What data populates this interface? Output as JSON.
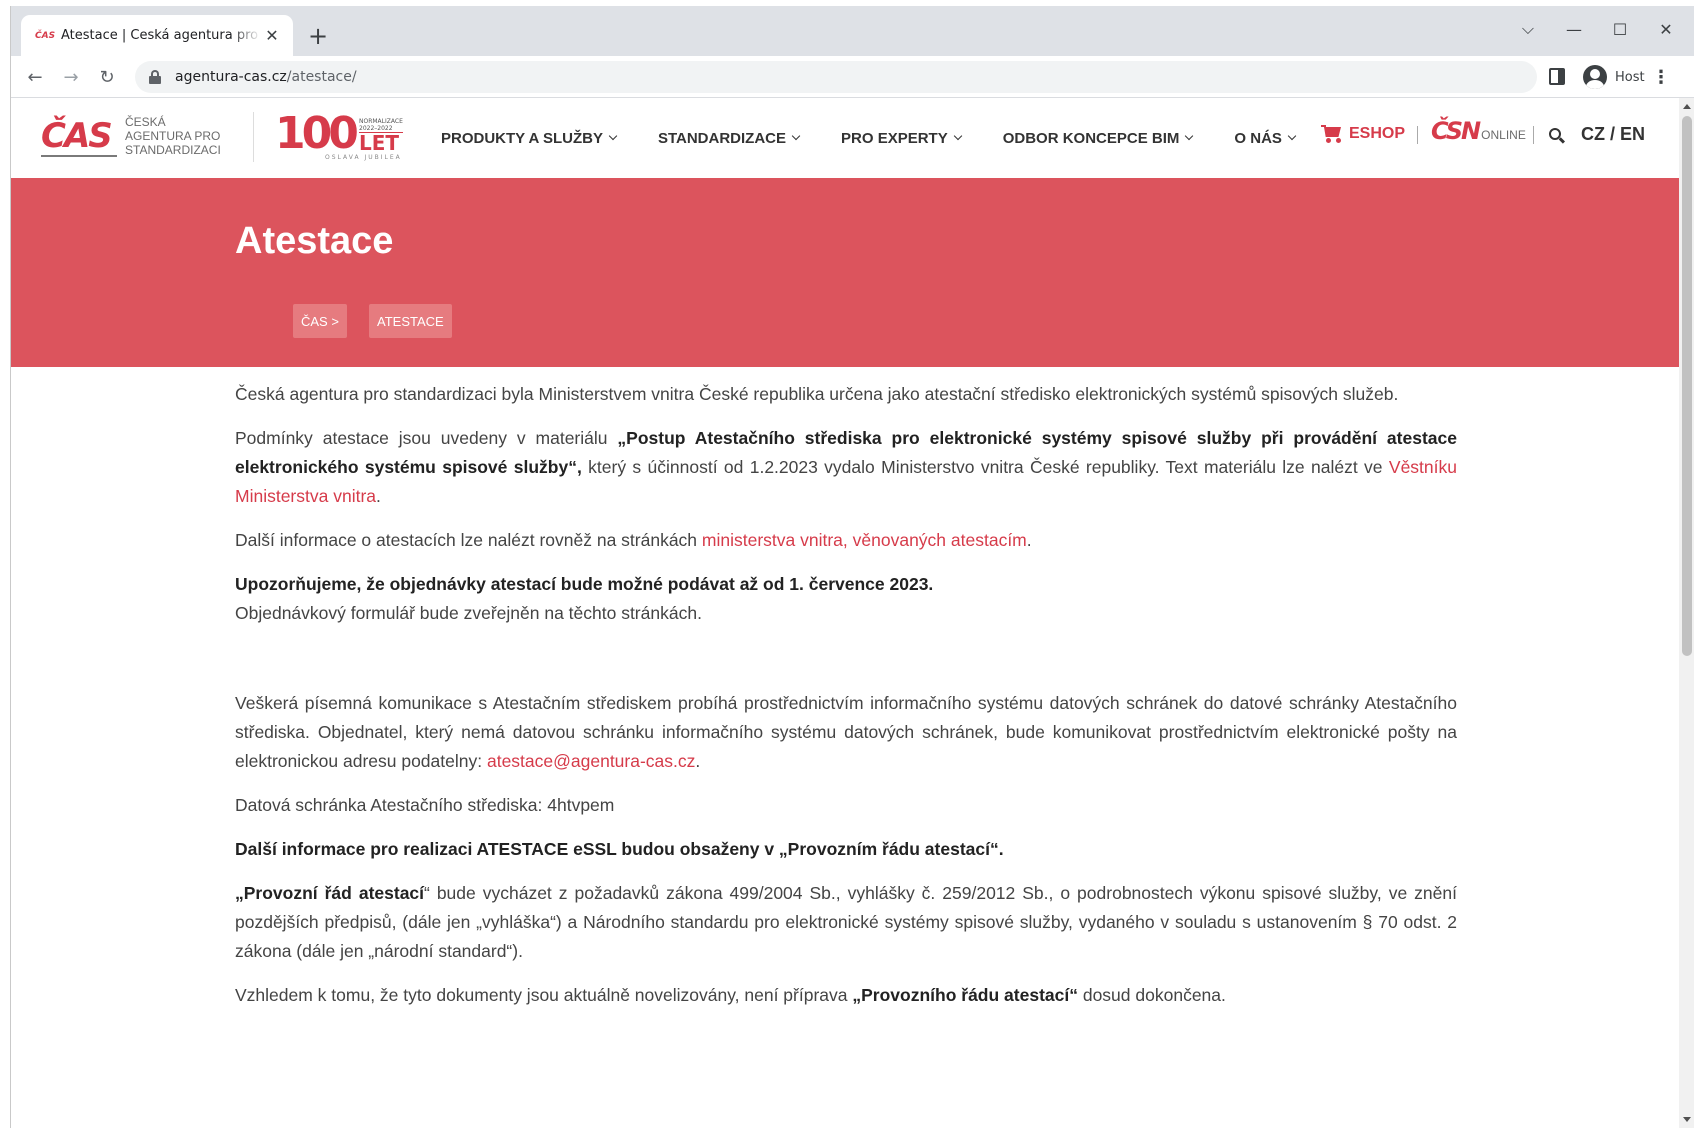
{
  "browser": {
    "tab_title": "Atestace | Česká agentura pro standardizaci",
    "new_tab": "+",
    "url_host": "agentura-cas.cz",
    "url_path": "/atestace/",
    "profile_name": "Host"
  },
  "site": {
    "logo_words": [
      "ČESKÁ",
      "AGENTURA PRO",
      "STANDARDIZACI"
    ],
    "logo_mark": "ČAS",
    "jubilee": {
      "number": "100",
      "small_top": "NORMALIZACE",
      "years": "2022–2022",
      "let": "LET",
      "caption": "OSLAVA JUBILEA"
    },
    "nav": [
      {
        "label": "PRODUKTY A SLUŽBY"
      },
      {
        "label": "STANDARDIZACE"
      },
      {
        "label": "PRO EXPERTY"
      },
      {
        "label": "ODBOR KONCEPCE BIM"
      },
      {
        "label": "O NÁS"
      }
    ],
    "eshop": "ESHOP",
    "csn_mark": "ČSN",
    "csn_online": "ONLINE",
    "lang": "CZ / EN"
  },
  "hero": {
    "title": "Atestace",
    "breadcrumb": [
      "ČAS  >",
      "ATESTACE"
    ]
  },
  "content": {
    "p1": "Česká agentura pro standardizaci byla Ministerstvem vnitra České republika určena jako atestační středisko elektronických systémů spisových služeb.",
    "p2_a": "Podmínky atestace jsou uvedeny v materiálu ",
    "p2_bold": "„Postup Atestačního střediska pro elektronické systémy spisové služby při provádění atestace elektronického systému spisové služby“,",
    "p2_b": " který s účinností od 1.2.2023 vydalo Ministerstvo vnitra České republiky. Text materiálu lze nalézt ve  ",
    "p2_link": "Věstníku Ministerstva vnitra",
    "p2_c": ".",
    "p3_a": "Další informace o atestacích lze nalézt rovněž na stránkách ",
    "p3_link": "ministerstva vnitra, věnovaných atestacím",
    "p3_b": ".",
    "p4_bold": "Upozorňujeme, že objednávky atestací  bude možné podávat až od 1. července 2023.",
    "p4_text": "Objednávkový formulář bude zveřejněn na těchto stránkách.",
    "p5_a": "Veškerá písemná komunikace s Atestačním střediskem probíhá prostřednictvím informačního systému datových schránek do datové schránky Atestačního střediska. Objednatel, který nemá datovou schránku informačního systému datových schránek, bude komunikovat prostřednictvím elektronické pošty na elektronickou adresu podatelny: ",
    "p5_link": "atestace@agentura-cas.cz",
    "p5_b": ".",
    "p6": "Datová schránka Atestačního střediska: 4htvpem",
    "p7_bold": "Další informace pro realizaci ATESTACE eSSL budou obsaženy v „Provozním řádu atestací“.",
    "p8_bold": "„Provozní řád atestací",
    "p8_text": "“ bude vycházet z požadavků zákona 499/2004 Sb., vyhlášky č. 259/2012 Sb., o podrobnostech výkonu spisové služby, ve znění pozdějších předpisů, (dále jen „vyhláška“) a Národního standardu pro elektronické systémy spisové služby, vydaného v souladu s ustanovením § 70 odst. 2 zákona (dále jen „národní standard“).",
    "p9_a": " Vzhledem k tomu, že tyto dokumenty jsou aktuálně novelizovány, není příprava ",
    "p9_bold": "„Provozního řádu atestací“",
    "p9_b": " dosud dokončena."
  },
  "colors": {
    "accent": "#dc545d",
    "link": "#d63b4a"
  }
}
